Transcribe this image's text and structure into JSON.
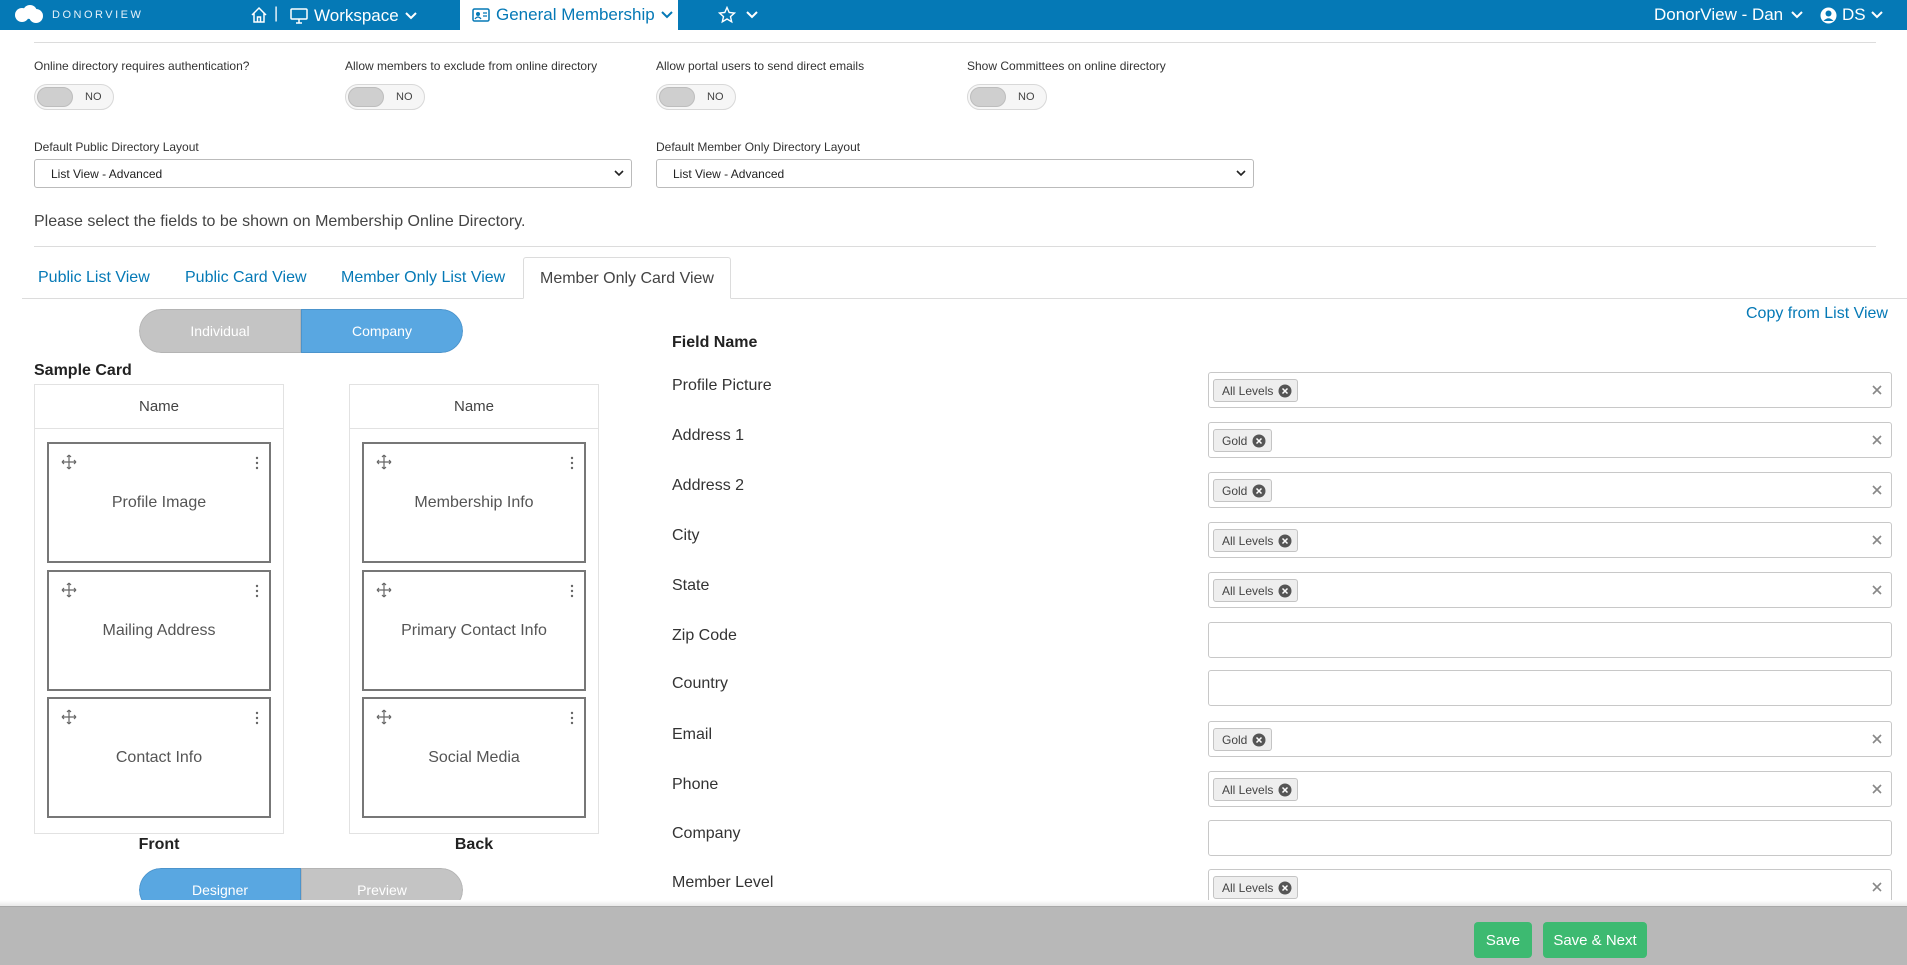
{
  "nav": {
    "brand": "DONORVIEW",
    "workspace": "Workspace",
    "module": "General Membership",
    "user": "DonorView - Dan",
    "initials": "DS"
  },
  "toggles": [
    {
      "label": "Online directory requires authentication?",
      "value": "NO"
    },
    {
      "label": "Allow members to exclude from online directory",
      "value": "NO"
    },
    {
      "label": "Allow portal users to send direct emails",
      "value": "NO"
    },
    {
      "label": "Show Committees on online directory",
      "value": "NO"
    }
  ],
  "layouts": {
    "public_label": "Default Public Directory Layout",
    "public_value": "List View - Advanced",
    "member_label": "Default Member Only Directory Layout",
    "member_value": "List View - Advanced"
  },
  "intro": "Please select the fields to be shown on Membership Online Directory.",
  "tabs": [
    "Public List View",
    "Public Card View",
    "Member Only List View",
    "Member Only Card View"
  ],
  "active_tab": "Member Only Card View",
  "type_switch": {
    "individual": "Individual",
    "company": "Company",
    "selected": "Company"
  },
  "copy_link": "Copy from List View",
  "sample": {
    "title": "Sample Card",
    "front": {
      "name": "Name",
      "blocks": [
        "Profile Image",
        "Mailing Address",
        "Contact Info"
      ],
      "caption": "Front"
    },
    "back": {
      "name": "Name",
      "blocks": [
        "Membership Info",
        "Primary Contact Info",
        "Social Media"
      ],
      "caption": "Back"
    }
  },
  "mode_switch": {
    "designer": "Designer",
    "preview": "Preview",
    "selected": "Designer"
  },
  "fields": {
    "header": "Field Name",
    "rows": [
      {
        "name": "Profile Picture",
        "chip": "All Levels"
      },
      {
        "name": "Address 1",
        "chip": "Gold"
      },
      {
        "name": "Address 2",
        "chip": "Gold"
      },
      {
        "name": "City",
        "chip": "All Levels"
      },
      {
        "name": "State",
        "chip": "All Levels"
      },
      {
        "name": "Zip Code",
        "chip": ""
      },
      {
        "name": "Country",
        "chip": ""
      },
      {
        "name": "Email",
        "chip": "Gold"
      },
      {
        "name": "Phone",
        "chip": "All Levels"
      },
      {
        "name": "Company",
        "chip": ""
      },
      {
        "name": "Member Level",
        "chip": "All Levels"
      }
    ]
  },
  "footer": {
    "save": "Save",
    "save_next": "Save & Next"
  },
  "colors": {
    "brand": "#0579b6",
    "toggle_on_accent": "#59a7e1",
    "save_green": "#3dba71"
  }
}
